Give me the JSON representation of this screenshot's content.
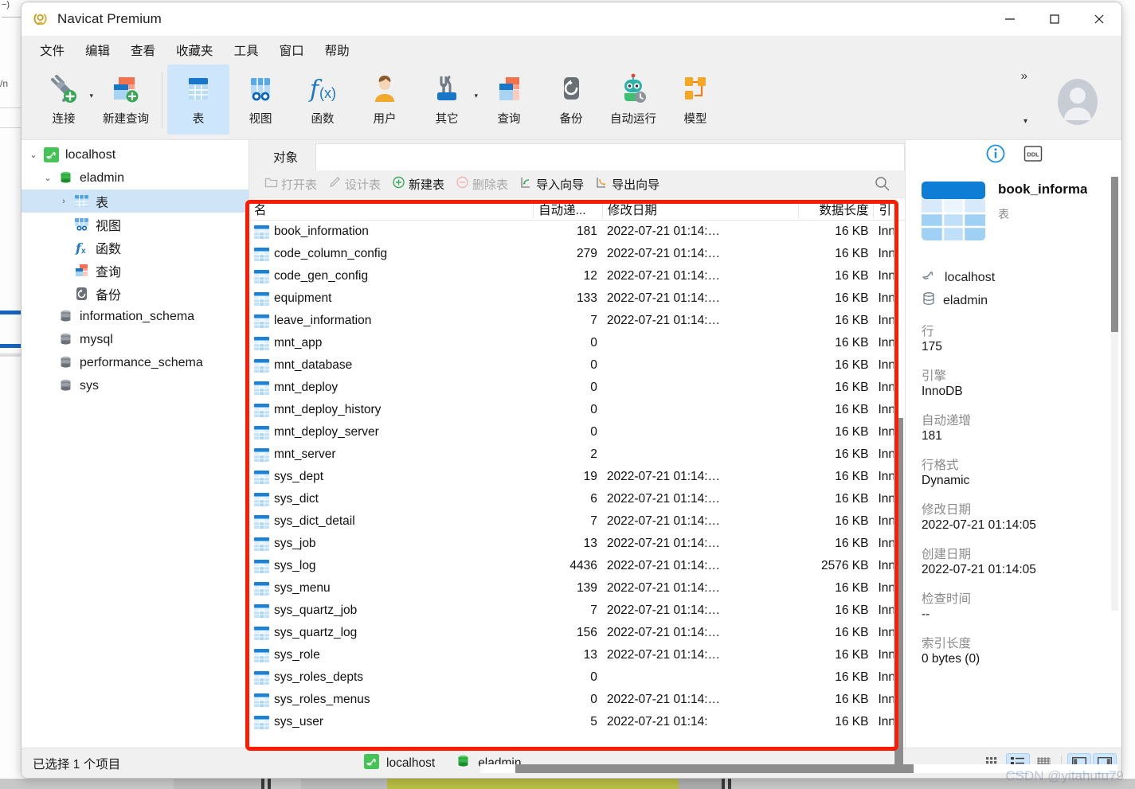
{
  "window": {
    "title": "Navicat Premium",
    "minimize_label": "—",
    "maximize_label": "▢",
    "close_label": "✕"
  },
  "menu": {
    "items": [
      {
        "label": "文件"
      },
      {
        "label": "编辑"
      },
      {
        "label": "查看"
      },
      {
        "label": "收藏夹"
      },
      {
        "label": "工具"
      },
      {
        "label": "窗口"
      },
      {
        "label": "帮助"
      }
    ]
  },
  "ribbon": {
    "items": [
      {
        "label": "连接",
        "icon": "connection-icon",
        "caret": true,
        "active": false
      },
      {
        "label": "新建查询",
        "icon": "new-query-icon",
        "caret": false,
        "active": false
      },
      {
        "label": "表",
        "icon": "table-icon",
        "caret": false,
        "active": true
      },
      {
        "label": "视图",
        "icon": "view-icon",
        "caret": false,
        "active": false
      },
      {
        "label": "函数",
        "icon": "function-icon",
        "caret": false,
        "active": false
      },
      {
        "label": "用户",
        "icon": "user-icon",
        "caret": false,
        "active": false
      },
      {
        "label": "其它",
        "icon": "other-icon",
        "caret": true,
        "active": false
      },
      {
        "label": "查询",
        "icon": "query-icon",
        "caret": false,
        "active": false
      },
      {
        "label": "备份",
        "icon": "backup-icon",
        "caret": false,
        "active": false
      },
      {
        "label": "自动运行",
        "icon": "automation-icon",
        "caret": false,
        "active": false
      },
      {
        "label": "模型",
        "icon": "model-icon",
        "caret": false,
        "active": false
      }
    ],
    "overflow_label": "»",
    "expand_label": "▾"
  },
  "sidebar": {
    "items": [
      {
        "label": "localhost",
        "icon": "mysql-dolphin-icon",
        "indent": 0,
        "chevron": "▾",
        "selected": false
      },
      {
        "label": "eladmin",
        "icon": "database-green-icon",
        "indent": 1,
        "chevron": "▾",
        "selected": false
      },
      {
        "label": "表",
        "icon": "table-icon",
        "indent": 2,
        "chevron": "›",
        "selected": true
      },
      {
        "label": "视图",
        "icon": "view-icon",
        "indent": 2,
        "chevron": "",
        "selected": false
      },
      {
        "label": "函数",
        "icon": "function-icon",
        "indent": 2,
        "chevron": "",
        "selected": false
      },
      {
        "label": "查询",
        "icon": "query-icon",
        "indent": 2,
        "chevron": "",
        "selected": false
      },
      {
        "label": "备份",
        "icon": "backup-icon",
        "indent": 2,
        "chevron": "",
        "selected": false
      },
      {
        "label": "information_schema",
        "icon": "database-gray-icon",
        "indent": 1,
        "chevron": "",
        "selected": false
      },
      {
        "label": "mysql",
        "icon": "database-gray-icon",
        "indent": 1,
        "chevron": "",
        "selected": false
      },
      {
        "label": "performance_schema",
        "icon": "database-gray-icon",
        "indent": 1,
        "chevron": "",
        "selected": false
      },
      {
        "label": "sys",
        "icon": "database-gray-icon",
        "indent": 1,
        "chevron": "",
        "selected": false
      }
    ]
  },
  "center": {
    "tab_label": "对象",
    "object_toolbar": [
      {
        "label": "打开表",
        "icon": "open-table-icon",
        "enabled": false
      },
      {
        "label": "设计表",
        "icon": "design-table-icon",
        "enabled": false
      },
      {
        "label": "新建表",
        "icon": "plus-circle-icon",
        "enabled": true
      },
      {
        "label": "删除表",
        "icon": "minus-circle-icon",
        "enabled": false
      },
      {
        "label": "导入向导",
        "icon": "import-icon",
        "enabled": true
      },
      {
        "label": "导出向导",
        "icon": "export-icon",
        "enabled": true
      }
    ],
    "search_icon": "search-icon",
    "grid": {
      "columns": [
        "名",
        "自动递...",
        "修改日期",
        "数据长度",
        "引"
      ],
      "rows": [
        {
          "name": "book_information",
          "auto": "181",
          "modified": "2022-07-21 01:14:…",
          "length": "16 KB",
          "engine": "Inn"
        },
        {
          "name": "code_column_config",
          "auto": "279",
          "modified": "2022-07-21 01:14:…",
          "length": "16 KB",
          "engine": "Inn"
        },
        {
          "name": "code_gen_config",
          "auto": "12",
          "modified": "2022-07-21 01:14:…",
          "length": "16 KB",
          "engine": "Inn"
        },
        {
          "name": "equipment",
          "auto": "133",
          "modified": "2022-07-21 01:14:…",
          "length": "16 KB",
          "engine": "Inn"
        },
        {
          "name": "leave_information",
          "auto": "7",
          "modified": "2022-07-21 01:14:…",
          "length": "16 KB",
          "engine": "Inn"
        },
        {
          "name": "mnt_app",
          "auto": "0",
          "modified": "",
          "length": "16 KB",
          "engine": "Inn"
        },
        {
          "name": "mnt_database",
          "auto": "0",
          "modified": "",
          "length": "16 KB",
          "engine": "Inn"
        },
        {
          "name": "mnt_deploy",
          "auto": "0",
          "modified": "",
          "length": "16 KB",
          "engine": "Inn"
        },
        {
          "name": "mnt_deploy_history",
          "auto": "0",
          "modified": "",
          "length": "16 KB",
          "engine": "Inn"
        },
        {
          "name": "mnt_deploy_server",
          "auto": "0",
          "modified": "",
          "length": "16 KB",
          "engine": "Inn"
        },
        {
          "name": "mnt_server",
          "auto": "2",
          "modified": "",
          "length": "16 KB",
          "engine": "Inn"
        },
        {
          "name": "sys_dept",
          "auto": "19",
          "modified": "2022-07-21 01:14:…",
          "length": "16 KB",
          "engine": "Inn"
        },
        {
          "name": "sys_dict",
          "auto": "6",
          "modified": "2022-07-21 01:14:…",
          "length": "16 KB",
          "engine": "Inn"
        },
        {
          "name": "sys_dict_detail",
          "auto": "7",
          "modified": "2022-07-21 01:14:…",
          "length": "16 KB",
          "engine": "Inn"
        },
        {
          "name": "sys_job",
          "auto": "13",
          "modified": "2022-07-21 01:14:…",
          "length": "16 KB",
          "engine": "Inn"
        },
        {
          "name": "sys_log",
          "auto": "4436",
          "modified": "2022-07-21 01:14:…",
          "length": "2576 KB",
          "engine": "Inn"
        },
        {
          "name": "sys_menu",
          "auto": "139",
          "modified": "2022-07-21 01:14:…",
          "length": "16 KB",
          "engine": "Inn"
        },
        {
          "name": "sys_quartz_job",
          "auto": "7",
          "modified": "2022-07-21 01:14:…",
          "length": "16 KB",
          "engine": "Inn"
        },
        {
          "name": "sys_quartz_log",
          "auto": "156",
          "modified": "2022-07-21 01:14:…",
          "length": "16 KB",
          "engine": "Inn"
        },
        {
          "name": "sys_role",
          "auto": "13",
          "modified": "2022-07-21 01:14:…",
          "length": "16 KB",
          "engine": "Inn"
        },
        {
          "name": "sys_roles_depts",
          "auto": "0",
          "modified": "",
          "length": "16 KB",
          "engine": "Inn"
        },
        {
          "name": "sys_roles_menus",
          "auto": "0",
          "modified": "2022-07-21 01:14:…",
          "length": "16 KB",
          "engine": "Inn"
        },
        {
          "name": "sys_user",
          "auto": "5",
          "modified": "2022-07-21 01:14:",
          "length": "16 KB",
          "engine": "Inn"
        }
      ]
    }
  },
  "info_panel": {
    "tabs": [
      {
        "icon": "info-circle-icon",
        "active": true
      },
      {
        "icon": "ddl-icon",
        "active": false
      }
    ],
    "object_name": "book_informa",
    "object_type": "表",
    "connection": "localhost",
    "database": "eladmin",
    "fields": [
      {
        "key": "行",
        "value": "175"
      },
      {
        "key": "引擎",
        "value": "InnoDB"
      },
      {
        "key": "自动递增",
        "value": "181"
      },
      {
        "key": "行格式",
        "value": "Dynamic"
      },
      {
        "key": "修改日期",
        "value": "2022-07-21 01:14:05"
      },
      {
        "key": "创建日期",
        "value": "2022-07-21 01:14:05"
      },
      {
        "key": "检查时间",
        "value": "--"
      },
      {
        "key": "索引长度",
        "value": "0 bytes (0)"
      }
    ]
  },
  "status_bar": {
    "left_text": "已选择 1 个项目",
    "connection": "localhost",
    "database": "eladmin",
    "view_modes": [
      {
        "icon": "grid-view-icon",
        "active": false
      },
      {
        "icon": "list-view-icon",
        "active": true
      },
      {
        "icon": "detail-view-icon",
        "active": false
      },
      {
        "icon": "left-panel-icon",
        "active": true
      },
      {
        "icon": "right-panel-icon",
        "active": true
      }
    ]
  },
  "watermark": {
    "text": "CSDN @yitahutu79"
  }
}
